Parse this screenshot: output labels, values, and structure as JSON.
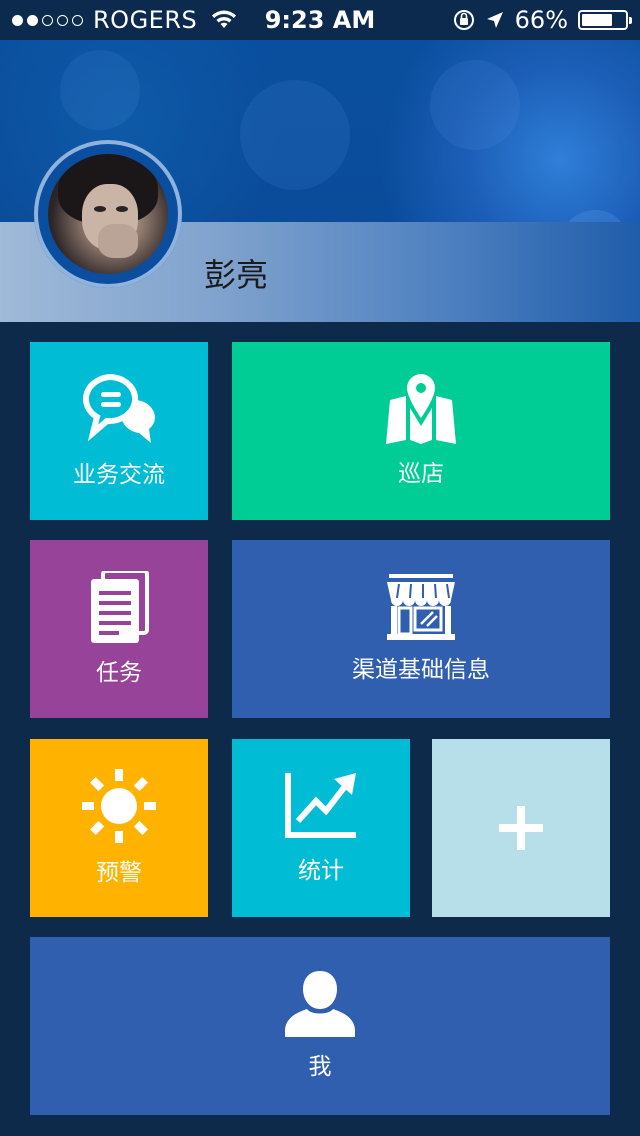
{
  "status_bar": {
    "carrier": "ROGERS",
    "time": "9:23 AM",
    "battery_percent": "66%",
    "battery_level": 0.66,
    "signal_bars_filled": 2,
    "signal_bars_total": 5
  },
  "profile": {
    "name": "彭亮"
  },
  "tiles": {
    "chat": {
      "label": "业务交流",
      "color": "#00bcd4",
      "icon": "chat-bubbles-icon"
    },
    "patrol": {
      "label": "巡店",
      "color": "#00cc96",
      "icon": "map-pin-icon"
    },
    "task": {
      "label": "任务",
      "color": "#974399",
      "icon": "documents-icon"
    },
    "channel": {
      "label": "渠道基础信息",
      "color": "#2f5fae",
      "icon": "storefront-icon"
    },
    "warning": {
      "label": "预警",
      "color": "#ffb300",
      "icon": "sun-icon"
    },
    "stats": {
      "label": "统计",
      "color": "#00bcd4",
      "icon": "trend-chart-icon"
    },
    "add": {
      "color": "#b6dfea",
      "icon": "plus-icon"
    },
    "me": {
      "label": "我",
      "color": "#2f5fae",
      "icon": "user-icon"
    }
  }
}
